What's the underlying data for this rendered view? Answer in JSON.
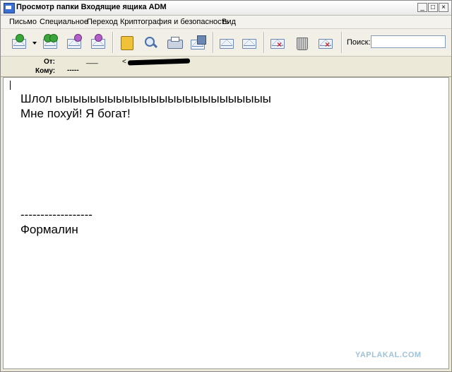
{
  "window": {
    "title": "Просмотр папки Входящие ящика ADM",
    "minimize_glyph": "_",
    "maximize_glyph": "□",
    "close_glyph": "×"
  },
  "menu": [
    "Письмо",
    "Специальное",
    "Переход",
    "Криптография и безопасность",
    "Вид"
  ],
  "toolbar": {
    "buttons": [
      "get-mail-icon",
      "reply-all-icon",
      "forward-icon",
      "reply-icon",
      "address-book-icon",
      "find-icon",
      "print-icon",
      "save-icon",
      "move-up-icon",
      "move-down-icon",
      "mark-spam-icon",
      "trash-icon",
      "delete-icon"
    ],
    "search_label": "Поиск:",
    "search_value": ""
  },
  "header": {
    "from_label": "От:",
    "from_value": "___",
    "from_address": "<",
    "to_label": "Кому:",
    "to_value": "-----"
  },
  "message": {
    "lines": [
      "Шлол ыыыыыыыыыыыыыыыыыыыыыыыыы",
      "Мне похуй! Я богат!",
      "------------------",
      "Формалин"
    ]
  },
  "watermark": "YAPLAKAL.COM"
}
